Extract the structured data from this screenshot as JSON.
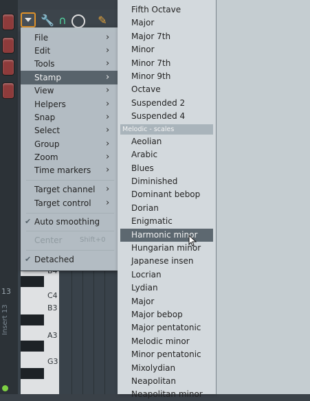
{
  "main_menu": {
    "items": [
      {
        "label": "File"
      },
      {
        "label": "Edit"
      },
      {
        "label": "Tools"
      },
      {
        "label": "Stamp"
      },
      {
        "label": "View"
      },
      {
        "label": "Helpers"
      },
      {
        "label": "Snap"
      },
      {
        "label": "Select"
      },
      {
        "label": "Group"
      },
      {
        "label": "Zoom"
      },
      {
        "label": "Time markers"
      },
      {
        "label": "Target channel"
      },
      {
        "label": "Target control"
      },
      {
        "label": "Auto smoothing"
      },
      {
        "label": "Center"
      },
      {
        "label": "Detached"
      }
    ],
    "center_shortcut": "Shift+0"
  },
  "stamp_submenu": {
    "chords": [
      "Fifth Octave",
      "Major",
      "Major 7th",
      "Minor",
      "Minor 7th",
      "Minor 9th",
      "Octave",
      "Suspended 2",
      "Suspended 4"
    ],
    "section_header": "Melodic - scales",
    "scales": [
      "Aeolian",
      "Arabic",
      "Blues",
      "Diminished",
      "Dominant bebop",
      "Dorian",
      "Enigmatic",
      "Harmonic minor",
      "Hungarian minor",
      "Japanese insen",
      "Locrian",
      "Lydian",
      "Major",
      "Major bebop",
      "Major pentatonic",
      "Melodic minor",
      "Minor pentatonic",
      "Mixolydian",
      "Neapolitan",
      "Neapolitan minor"
    ],
    "highlighted": "Harmonic minor"
  },
  "piano_roll": {
    "key_labels": [
      "B4",
      "C4",
      "B3",
      "A3",
      "G3"
    ],
    "insert_label": "Insert 13",
    "insert_number": "13"
  },
  "icons": {
    "menu": "dropdown-arrow-icon",
    "tools": "wrench-icon",
    "magnet": "magnet-icon",
    "playback": "circle-icon",
    "stamp": "pencil-icon"
  },
  "colors": {
    "menu_bg": "#bcc6cc",
    "submenu_bg": "#d3d9dd",
    "highlight": "#58636b",
    "accent": "#e0922a"
  }
}
